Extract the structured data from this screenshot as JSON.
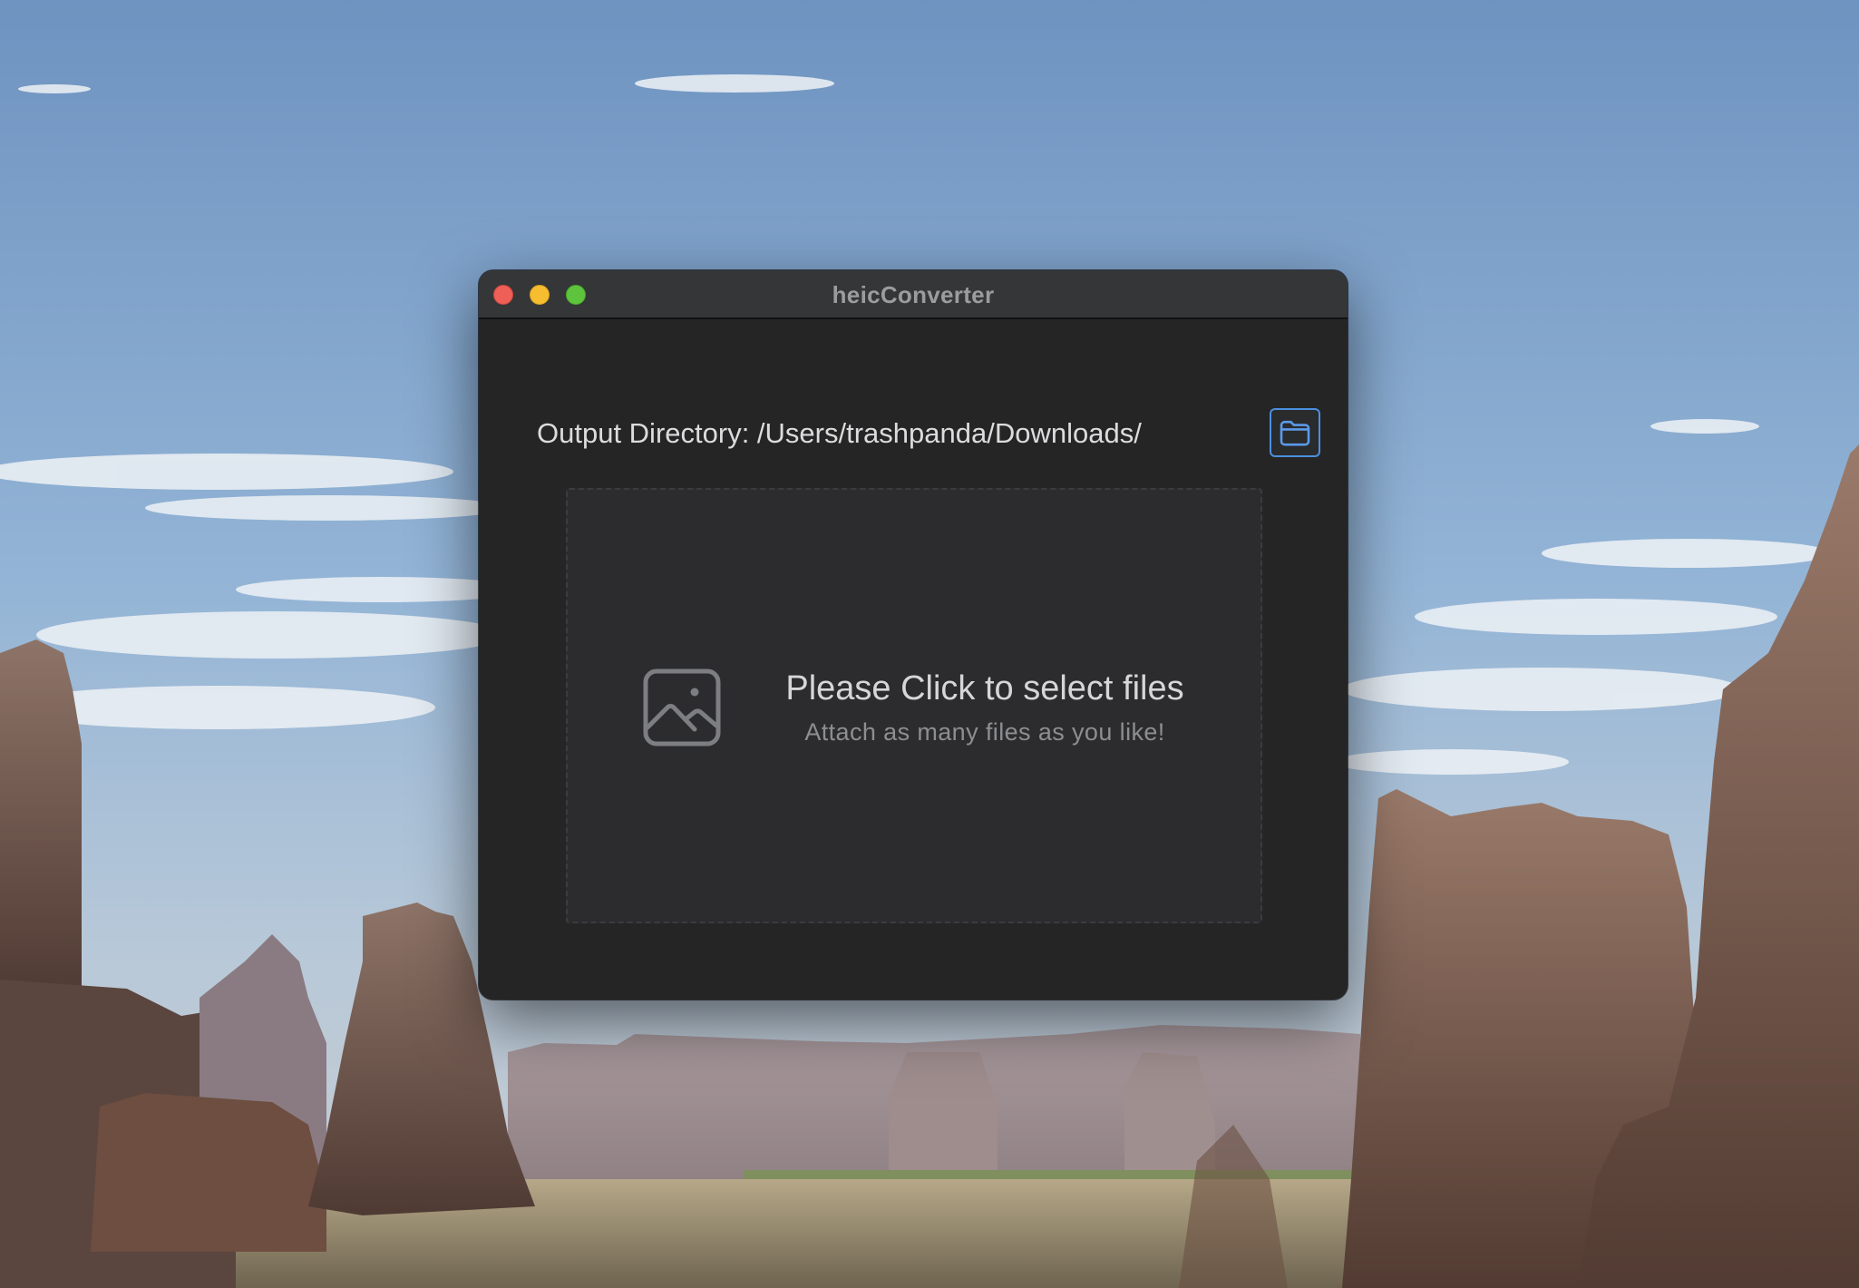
{
  "window": {
    "title": "heicConverter"
  },
  "output": {
    "label": "Output Directory: /Users/trashpanda/Downloads/",
    "choose_folder_icon": "folder-icon"
  },
  "dropzone": {
    "icon": "image-icon",
    "title": "Please Click to select files",
    "subtitle": "Attach as many files as you like!"
  },
  "colors": {
    "window_background": "#252526",
    "titlebar": "#353638",
    "dropzone_background": "#2c2c2e",
    "accent": "#4c8fe0",
    "close": "#ed5f57",
    "minimize": "#f5bd2f",
    "zoom": "#5fc43d"
  }
}
